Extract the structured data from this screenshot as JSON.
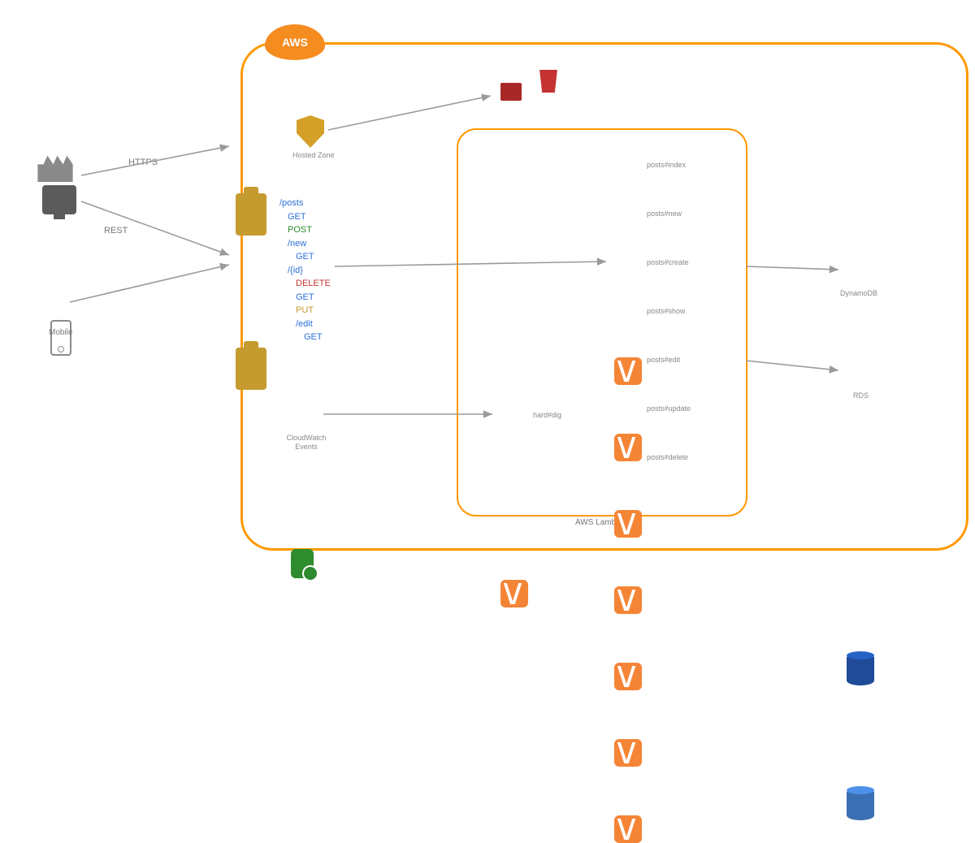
{
  "header": {
    "aws_badge": "AWS"
  },
  "clients": {
    "users_label": "",
    "desktop_label": "",
    "mobile_label": "Mobile",
    "protocol_https": "HTTPS",
    "protocol_rest": "REST"
  },
  "aws": {
    "hosted_zone_label": "Hosted Zone",
    "cloudwatch_label_l1": "CloudWatch",
    "cloudwatch_label_l2": "Events",
    "lambda_group_label": "AWS Lambda"
  },
  "routes": {
    "r1": "/posts",
    "r2": "GET",
    "r3": "POST",
    "r4": "/new",
    "r5": "GET",
    "r6": "/{id}",
    "r7": "DELETE",
    "r8": "GET",
    "r9": "PUT",
    "r10": "/edit",
    "r11": "GET"
  },
  "lambdas": {
    "f1": "posts#index",
    "f2": "posts#new",
    "f3": "posts#create",
    "f4": "posts#show",
    "f5": "posts#edit",
    "f6": "posts#update",
    "f7": "posts#delete",
    "cron": "hard#dig"
  },
  "databases": {
    "dynamo": "DynamoDB",
    "rds": "RDS"
  }
}
